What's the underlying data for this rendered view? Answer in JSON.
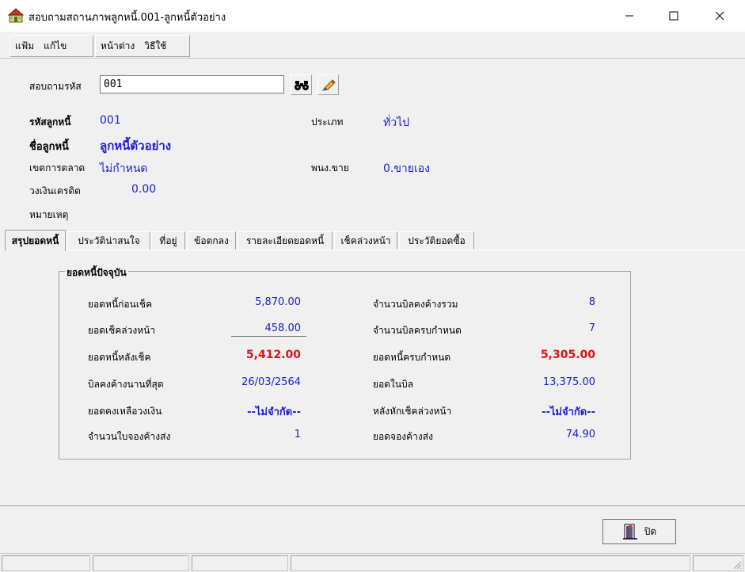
{
  "window": {
    "title": "สอบถามสถานภาพลูกหนี้.001-ลูกหนี้ตัวอย่าง"
  },
  "menu": {
    "group1": [
      "แฟ้ม",
      "แก้ไข"
    ],
    "group2": [
      "หน้าต่าง",
      "วิธีใช้"
    ]
  },
  "search": {
    "label": "สอบถามรหัส",
    "value": "001"
  },
  "info": {
    "code_label": "รหัสลูกหนี้",
    "code_value": "001",
    "type_label": "ประเภท",
    "type_value": "ทั่วไป",
    "name_label": "ชื่อลูกหนี้",
    "name_value": "ลูกหนี้ตัวอย่าง",
    "zone_label": "เขตการตลาด",
    "zone_value": "ไม่กำหนด",
    "sales_label": "พนง.ขาย",
    "sales_value": "0.ขายเอง",
    "credit_label": "วงเงินเครดิต",
    "credit_value": "0.00",
    "note_label": "หมายเหตุ"
  },
  "tabs": [
    "สรุปยอดหนี้",
    "ประวัติน่าสนใจ",
    "ที่อยู่",
    "ข้อตกลง",
    "รายละเอียดยอดหนี้",
    "เช็คล่วงหน้า",
    "ประวัติยอดซื้อ"
  ],
  "summary": {
    "legend": "ยอดหนี้ปัจจุบัน",
    "left": [
      {
        "label": "ยอดหนี้ก่อนเช็ค",
        "value": "5,870.00"
      },
      {
        "label": "ยอดเช็คล่วงหน้า",
        "value": "458.00"
      },
      {
        "label": "ยอดหนี้หลังเช็ค",
        "value": "5,412.00"
      },
      {
        "label": "บิลคงค้างนานที่สุด",
        "value": "26/03/2564"
      },
      {
        "label": "ยอดคงเหลือวงเงิน",
        "value": "--ไม่จำกัด--"
      },
      {
        "label": "จำนวนใบจองค้างส่ง",
        "value": "1"
      }
    ],
    "right": [
      {
        "label": "จำนวนบิลคงค้างรวม",
        "value": "8"
      },
      {
        "label": "จำนวนบิลครบกำหนด",
        "value": "7"
      },
      {
        "label": "ยอดหนี้ครบกำหนด",
        "value": "5,305.00"
      },
      {
        "label": "ยอดในบิล",
        "value": "13,375.00"
      },
      {
        "label": "หลังหักเช็คล่วงหน้า",
        "value": "--ไม่จำกัด--"
      },
      {
        "label": "ยอดจองค้างส่ง",
        "value": "74.90"
      }
    ]
  },
  "buttons": {
    "close_label": "ปิด"
  },
  "colors": {
    "accent_blue": "#1c1cd4",
    "highlight_red": "#e01010"
  }
}
